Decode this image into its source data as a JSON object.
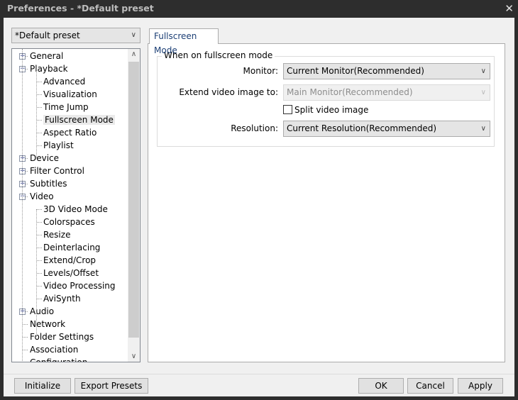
{
  "window": {
    "title": "Preferences - *Default preset",
    "close": "✕"
  },
  "preset": {
    "value": "*Default preset"
  },
  "tree": [
    {
      "label": "General",
      "level": 0,
      "exp": "+"
    },
    {
      "label": "Playback",
      "level": 0,
      "exp": "−"
    },
    {
      "label": "Advanced",
      "level": 1
    },
    {
      "label": "Visualization",
      "level": 1
    },
    {
      "label": "Time Jump",
      "level": 1
    },
    {
      "label": "Fullscreen Mode",
      "level": 1,
      "selected": true
    },
    {
      "label": "Aspect Ratio",
      "level": 1
    },
    {
      "label": "Playlist",
      "level": 1
    },
    {
      "label": "Device",
      "level": 0,
      "exp": "+"
    },
    {
      "label": "Filter Control",
      "level": 0,
      "exp": "+"
    },
    {
      "label": "Subtitles",
      "level": 0,
      "exp": "+"
    },
    {
      "label": "Video",
      "level": 0,
      "exp": "−"
    },
    {
      "label": "3D Video Mode",
      "level": 1
    },
    {
      "label": "Colorspaces",
      "level": 1
    },
    {
      "label": "Resize",
      "level": 1
    },
    {
      "label": "Deinterlacing",
      "level": 1
    },
    {
      "label": "Extend/Crop",
      "level": 1
    },
    {
      "label": "Levels/Offset",
      "level": 1
    },
    {
      "label": "Video Processing",
      "level": 1
    },
    {
      "label": "AviSynth",
      "level": 1
    },
    {
      "label": "Audio",
      "level": 0,
      "exp": "+"
    },
    {
      "label": "Network",
      "level": 0
    },
    {
      "label": "Folder Settings",
      "level": 0
    },
    {
      "label": "Association",
      "level": 0
    },
    {
      "label": "Configuration",
      "level": 0
    }
  ],
  "tab": {
    "label": "Fullscreen Mode"
  },
  "group": {
    "title": "When on fullscreen mode",
    "monitor_label": "Monitor:",
    "monitor_value": "Current Monitor(Recommended)",
    "extend_label": "Extend video image to:",
    "extend_value": "Main Monitor(Recommended)",
    "split_label": "Split video image",
    "resolution_label": "Resolution:",
    "resolution_value": "Current Resolution(Recommended)"
  },
  "buttons": {
    "initialize": "Initialize",
    "export": "Export Presets",
    "ok": "OK",
    "cancel": "Cancel",
    "apply": "Apply"
  }
}
